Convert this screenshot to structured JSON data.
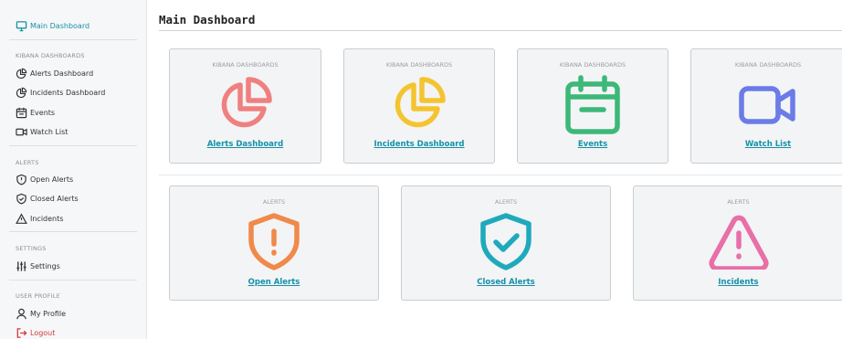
{
  "sidebar": {
    "main_dashboard": "Main Dashboard",
    "sections": {
      "kibana": "KIBANA DASHBOARDS",
      "alerts": "ALERTS",
      "settings": "SETTINGS",
      "user_profile": "USER PROFILE"
    },
    "items": {
      "alerts_dashboard": "Alerts Dashboard",
      "incidents_dashboard": "Incidents Dashboard",
      "events": "Events",
      "watch_list": "Watch List",
      "open_alerts": "Open Alerts",
      "closed_alerts": "Closed Alerts",
      "incidents": "Incidents",
      "settings": "Settings",
      "my_profile": "My Profile",
      "logout": "Logout"
    }
  },
  "main": {
    "title": "Main Dashboard",
    "kibana_cards": [
      {
        "category": "KIBANA DASHBOARDS",
        "label": "Alerts Dashboard",
        "icon": "pie-chart-icon",
        "color": "#f08080"
      },
      {
        "category": "KIBANA DASHBOARDS",
        "label": "Incidents Dashboard",
        "icon": "pie-chart-icon",
        "color": "#f4c430"
      },
      {
        "category": "KIBANA DASHBOARDS",
        "label": "Events",
        "icon": "calendar-icon",
        "color": "#3cb878"
      },
      {
        "category": "KIBANA DASHBOARDS",
        "label": "Watch List",
        "icon": "video-camera-icon",
        "color": "#6b7be8"
      }
    ],
    "alert_cards": [
      {
        "category": "ALERTS",
        "label": "Open Alerts",
        "icon": "shield-alert-icon",
        "color": "#f0894a"
      },
      {
        "category": "ALERTS",
        "label": "Closed Alerts",
        "icon": "shield-check-icon",
        "color": "#1fa9bd"
      },
      {
        "category": "ALERTS",
        "label": "Incidents",
        "icon": "warning-triangle-icon",
        "color": "#e86fa8"
      }
    ]
  },
  "colors": {
    "accent": "#1591a8",
    "logout": "#d13a3a"
  }
}
